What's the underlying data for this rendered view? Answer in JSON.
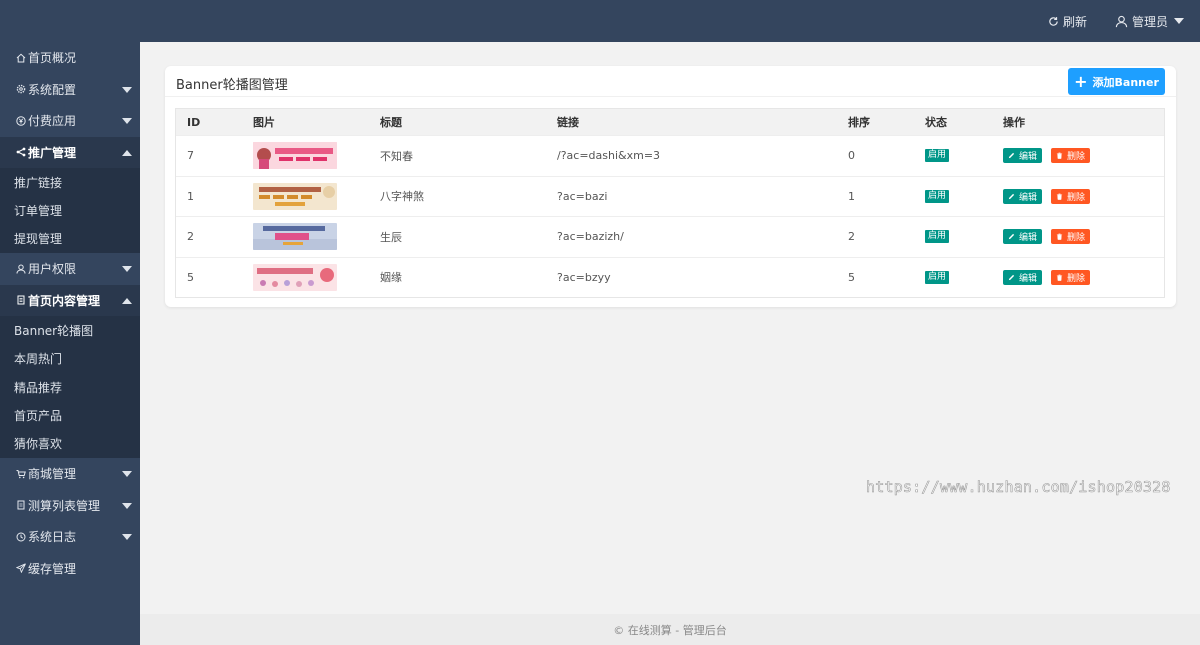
{
  "header": {
    "refresh_label": "刷新",
    "user_label": "管理员"
  },
  "sidebar": {
    "items": [
      {
        "label": "首页概况",
        "icon": "home-icon"
      },
      {
        "label": "系统配置",
        "icon": "gear-icon"
      },
      {
        "label": "付费应用",
        "icon": "yen-circle-icon"
      },
      {
        "label": "推广管理",
        "icon": "share-icon"
      },
      {
        "label": "推广链接"
      },
      {
        "label": "订单管理"
      },
      {
        "label": "提现管理"
      },
      {
        "label": "用户权限",
        "icon": "user-icon"
      },
      {
        "label": "首页内容管理",
        "icon": "file-icon"
      },
      {
        "label": "Banner轮播图"
      },
      {
        "label": "本周热门"
      },
      {
        "label": "精品推荐"
      },
      {
        "label": "首页产品"
      },
      {
        "label": "猜你喜欢"
      },
      {
        "label": "商城管理",
        "icon": "cart-icon"
      },
      {
        "label": "测算列表管理",
        "icon": "list-icon"
      },
      {
        "label": "系统日志",
        "icon": "clock-icon"
      },
      {
        "label": "缓存管理",
        "icon": "paper-plane-icon"
      }
    ]
  },
  "main": {
    "title": "Banner轮播图管理",
    "add_button": "添加Banner",
    "columns": [
      "ID",
      "图片",
      "标题",
      "链接",
      "排序",
      "状态",
      "操作"
    ],
    "rows": [
      {
        "id": "7",
        "title": "不知春",
        "link": "/?ac=dashi&xm=3",
        "sort": "0",
        "status": "启用",
        "edit": "编辑",
        "delete": "删除"
      },
      {
        "id": "1",
        "title": "八字神煞",
        "link": "?ac=bazi",
        "sort": "1",
        "status": "启用",
        "edit": "编辑",
        "delete": "删除"
      },
      {
        "id": "2",
        "title": "生辰",
        "link": "?ac=bazizh/",
        "sort": "2",
        "status": "启用",
        "edit": "编辑",
        "delete": "删除"
      },
      {
        "id": "5",
        "title": "姻缘",
        "link": "?ac=bzyy",
        "sort": "5",
        "status": "启用",
        "edit": "编辑",
        "delete": "删除"
      }
    ]
  },
  "watermark": "https://www.huzhan.com/ishop20328",
  "footer": "© 在线测算 - 管理后台",
  "colors": {
    "sidebar": "#34455e",
    "primary_button": "#1e9fff",
    "status_badge": "#009688",
    "edit_button": "#009688",
    "delete_button": "#ff5722"
  }
}
